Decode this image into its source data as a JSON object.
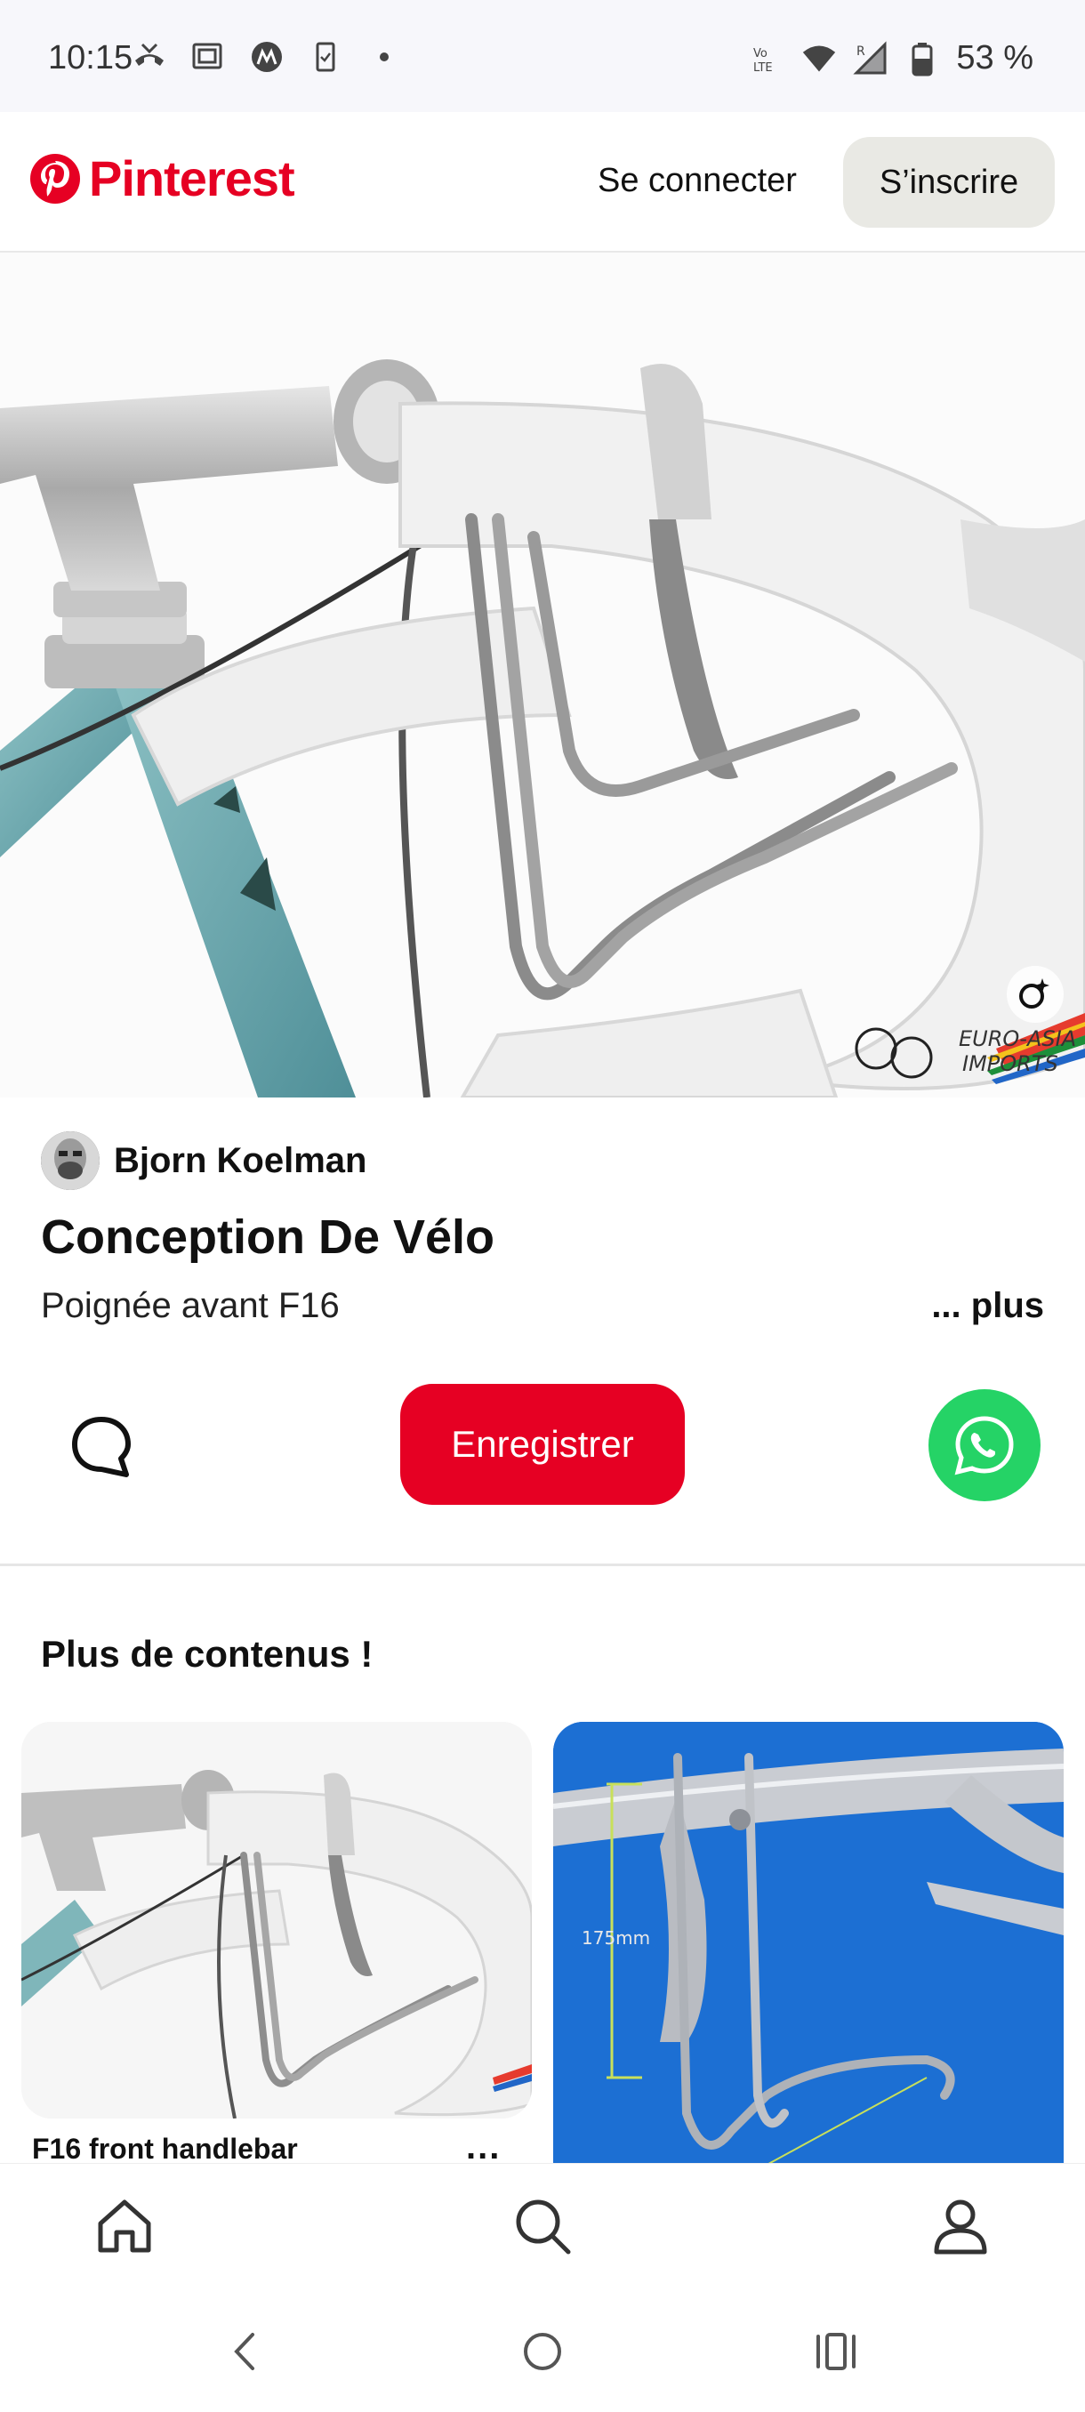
{
  "status_bar": {
    "time": "10:15",
    "battery": "53 %",
    "left_icons": [
      "missed-call-icon",
      "cast-icon",
      "motorola-icon",
      "clipboard-icon",
      "dot-icon"
    ],
    "right_icons": [
      "volte-icon",
      "wifi-icon",
      "signal-icon",
      "battery-icon"
    ]
  },
  "header": {
    "logo_text": "Pinterest",
    "login_label": "Se connecter",
    "signup_label": "S’inscrire",
    "brand_color": "#e60023"
  },
  "pin": {
    "author": "Bjorn Koelman",
    "title": "Conception De Vélo",
    "description": "Poignée avant F16",
    "more_label": "... plus",
    "save_label": "Enregistrer",
    "watermark_line1": "EURO-ASIA",
    "watermark_line2": "IMPORTS"
  },
  "more_section": {
    "title": "Plus de contenus !",
    "cards": [
      {
        "title": "F16 front handlebar",
        "menu": "..."
      },
      {
        "title": "",
        "measure_label": "175mm"
      }
    ]
  },
  "bottom_nav": {
    "items": [
      "home-icon",
      "search-icon",
      "profile-icon"
    ]
  },
  "system_nav": {
    "items": [
      "back-icon",
      "home-circle-icon",
      "recents-icon"
    ]
  }
}
